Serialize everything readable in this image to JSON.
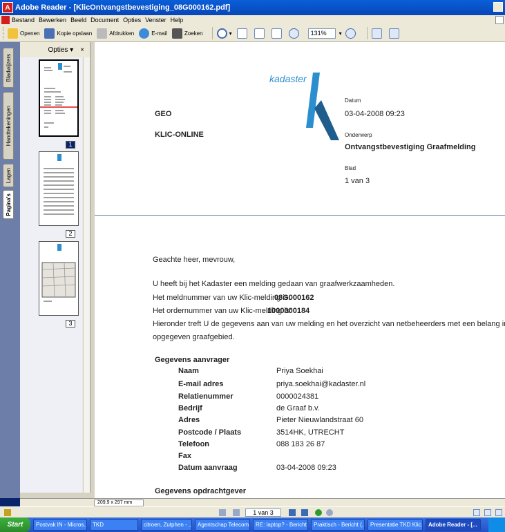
{
  "window": {
    "title": "Adobe Reader - [KlicOntvangstbevestiging_08G000162.pdf]"
  },
  "menu": [
    "Bestand",
    "Bewerken",
    "Beeld",
    "Document",
    "Opties",
    "Venster",
    "Help"
  ],
  "toolbar": {
    "open": "Openen",
    "save_copy": "Kopie opslaan",
    "print": "Afdrukken",
    "email": "E-mail",
    "search": "Zoeken",
    "zoom": "131%"
  },
  "nav_tabs": [
    "Bladwijzers",
    "Handtekeningen",
    "Lagen",
    "Pagina's"
  ],
  "panel": {
    "options": "Opties ▾",
    "close": "×",
    "thumbnails": [
      "1",
      "2",
      "3"
    ]
  },
  "document": {
    "logo": "kadaster",
    "left_headers": [
      "GEO",
      "KLIC-ONLINE"
    ],
    "datum_label": "Datum",
    "datum_value": "03-04-2008 09:23",
    "onderwerp_label": "Onderwerp",
    "onderwerp_value": "Ontvangstbevestiging Graafmelding",
    "blad_label": "Blad",
    "blad_value": "1 van 3",
    "greeting": "Geachte heer, mevrouw,",
    "intro": "U heeft bij het Kadaster een melding gedaan van graafwerkzaamheden.",
    "meldnummer_label": "Het meldnummer van uw Klic-melding is:",
    "meldnummer_value": "08G000162",
    "ordernummer_label": "Het ordernummer van uw Klic-melding is:",
    "ordernummer_value": "1000000184",
    "body_line1": "Hieronder treft U de gegevens aan van uw melding en het overzicht van netbeheerders met een belang in het door u",
    "body_line2": "opgegeven graafgebied.",
    "section_aanvrager": "Gegevens aanvrager",
    "fields": [
      {
        "label": "Naam",
        "value": "Priya Soekhai"
      },
      {
        "label": "E-mail adres",
        "value": "priya.soekhai@kadaster.nl"
      },
      {
        "label": "Relatienummer",
        "value": "0000024381"
      },
      {
        "label": "Bedrijf",
        "value": "de Graaf b.v."
      },
      {
        "label": "Adres",
        "value": "Pieter Nieuwlandstraat 60"
      },
      {
        "label": "Postcode / Plaats",
        "value": "3514HK, UTRECHT"
      },
      {
        "label": "Telefoon",
        "value": "088 183 26 87"
      },
      {
        "label": "Fax",
        "value": ""
      },
      {
        "label": "Datum aanvraag",
        "value": "03-04-2008 09:23"
      }
    ],
    "section_opdrachtgever": "Gegevens opdrachtgever"
  },
  "status": {
    "page_size": "209,9 x 297 mm",
    "page_field": "1 van 3"
  },
  "taskbar": {
    "start": "Start",
    "tasks": [
      "Postvak IN - Micros...",
      "TKD",
      "citroen, Zutphen - ...",
      "Agentschap Telecom",
      "RE: laptop? - Bericht...",
      "Praktisch - Bericht (...",
      "Presentatie TKD Klic...",
      "Adobe Reader - [..."
    ]
  }
}
